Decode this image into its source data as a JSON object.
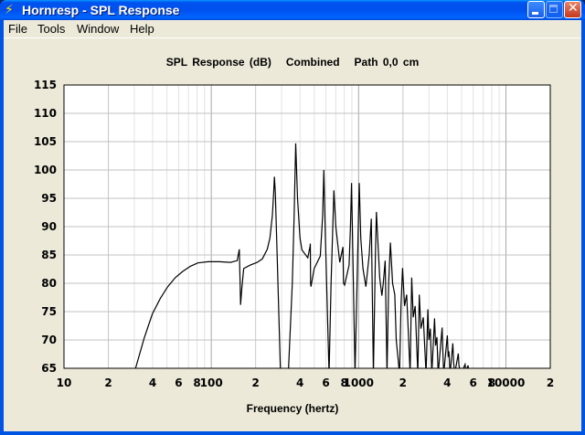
{
  "window": {
    "title": "Hornresp - SPL Response",
    "icon": "lightning-icon"
  },
  "menu": [
    "File",
    "Tools",
    "Window",
    "Help"
  ],
  "chart_data": {
    "type": "line",
    "title": "SPL Response (dB)   Combined   Path 0,0 cm",
    "xlabel": "Frequency (hertz)",
    "ylabel": "",
    "xscale": "log",
    "xlim": [
      10,
      20000
    ],
    "ylim": [
      65,
      115
    ],
    "grid": true,
    "y_ticks": [
      65,
      70,
      75,
      80,
      85,
      90,
      95,
      100,
      105,
      110,
      115
    ],
    "x_ticks": [
      {
        "value": 10,
        "label": "10"
      },
      {
        "value": 20,
        "label": "2"
      },
      {
        "value": 40,
        "label": "4"
      },
      {
        "value": 60,
        "label": "6"
      },
      {
        "value": 80,
        "label": "8"
      },
      {
        "value": 100,
        "label": "100"
      },
      {
        "value": 200,
        "label": "2"
      },
      {
        "value": 400,
        "label": "4"
      },
      {
        "value": 600,
        "label": "6"
      },
      {
        "value": 800,
        "label": "8"
      },
      {
        "value": 1000,
        "label": "1000"
      },
      {
        "value": 2000,
        "label": "2"
      },
      {
        "value": 4000,
        "label": "4"
      },
      {
        "value": 6000,
        "label": "6"
      },
      {
        "value": 8000,
        "label": "8"
      },
      {
        "value": 10000,
        "label": "10000"
      },
      {
        "value": 20000,
        "label": "2"
      }
    ],
    "series": [
      {
        "name": "SPL",
        "color": "#000000",
        "points": [
          [
            30.6,
            65
          ],
          [
            35,
            70.3
          ],
          [
            39.8,
            74.6
          ],
          [
            45,
            77.3
          ],
          [
            50.6,
            79.4
          ],
          [
            57,
            81
          ],
          [
            64,
            82.1
          ],
          [
            72,
            83
          ],
          [
            81,
            83.6
          ],
          [
            95,
            83.8
          ],
          [
            114,
            83.8
          ],
          [
            135,
            83.7
          ],
          [
            150,
            84
          ],
          [
            155,
            86
          ],
          [
            157,
            80
          ],
          [
            158,
            76.2
          ],
          [
            161,
            79
          ],
          [
            166,
            82.6
          ],
          [
            183,
            83.2
          ],
          [
            205,
            83.7
          ],
          [
            222,
            84.3
          ],
          [
            240,
            86
          ],
          [
            250,
            88
          ],
          [
            260,
            92
          ],
          [
            265,
            96
          ],
          [
            268,
            98.8
          ],
          [
            272,
            96
          ],
          [
            280,
            85
          ],
          [
            295,
            64
          ],
          [
            333,
            64
          ],
          [
            355,
            80
          ],
          [
            365,
            92
          ],
          [
            374,
            104.7
          ],
          [
            385,
            95
          ],
          [
            400,
            88
          ],
          [
            412,
            85.9
          ],
          [
            452,
            84.5
          ],
          [
            468,
            86.5
          ],
          [
            470,
            87
          ],
          [
            472,
            80
          ],
          [
            475,
            79.4
          ],
          [
            499,
            82.6
          ],
          [
            549,
            84.8
          ],
          [
            570,
            92
          ],
          [
            581,
            100
          ],
          [
            595,
            88
          ],
          [
            630,
            64
          ],
          [
            650,
            80
          ],
          [
            680,
            96.4
          ],
          [
            700,
            90
          ],
          [
            745,
            83.7
          ],
          [
            783,
            86.4
          ],
          [
            790,
            80
          ],
          [
            803,
            79.7
          ],
          [
            862,
            83.2
          ],
          [
            880,
            90
          ],
          [
            895,
            97.7
          ],
          [
            910,
            88
          ],
          [
            945,
            64
          ],
          [
            985,
            85
          ],
          [
            1010,
            97.7
          ],
          [
            1035,
            88
          ],
          [
            1070,
            82.6
          ],
          [
            1120,
            79.4
          ],
          [
            1180,
            85
          ],
          [
            1220,
            91.4
          ],
          [
            1260,
            64
          ],
          [
            1300,
            85
          ],
          [
            1320,
            92.6
          ],
          [
            1390,
            81
          ],
          [
            1440,
            77.8
          ],
          [
            1470,
            80
          ],
          [
            1514,
            84
          ],
          [
            1560,
            64
          ],
          [
            1600,
            80
          ],
          [
            1643,
            87.2
          ],
          [
            1700,
            80
          ],
          [
            1760,
            78
          ],
          [
            1800,
            70
          ],
          [
            1895,
            64
          ],
          [
            1940,
            76
          ],
          [
            1987,
            82.7
          ],
          [
            2050,
            76
          ],
          [
            2120,
            78
          ],
          [
            2237,
            64
          ],
          [
            2292,
            81
          ],
          [
            2350,
            74
          ],
          [
            2420,
            76
          ],
          [
            2523,
            64
          ],
          [
            2581,
            78
          ],
          [
            2650,
            72
          ],
          [
            2750,
            74
          ],
          [
            2870,
            64
          ],
          [
            2954,
            75.4
          ],
          [
            3000,
            70
          ],
          [
            3070,
            72
          ],
          [
            3140,
            64
          ],
          [
            3278,
            73.8
          ],
          [
            3330,
            69
          ],
          [
            3400,
            70.5
          ],
          [
            3471,
            64
          ],
          [
            3690,
            72.2
          ],
          [
            3730,
            68
          ],
          [
            3781,
            64
          ],
          [
            4004,
            70.8
          ],
          [
            4060,
            67
          ],
          [
            4100,
            68
          ],
          [
            4180,
            64
          ],
          [
            4364,
            69.4
          ],
          [
            4420,
            66
          ],
          [
            4490,
            64
          ],
          [
            4754,
            67.6
          ],
          [
            4800,
            65.5
          ],
          [
            4962,
            64
          ],
          [
            5278,
            65.7
          ],
          [
            5350,
            64.5
          ],
          [
            5540,
            65.5
          ],
          [
            5600,
            64
          ]
        ]
      }
    ]
  }
}
